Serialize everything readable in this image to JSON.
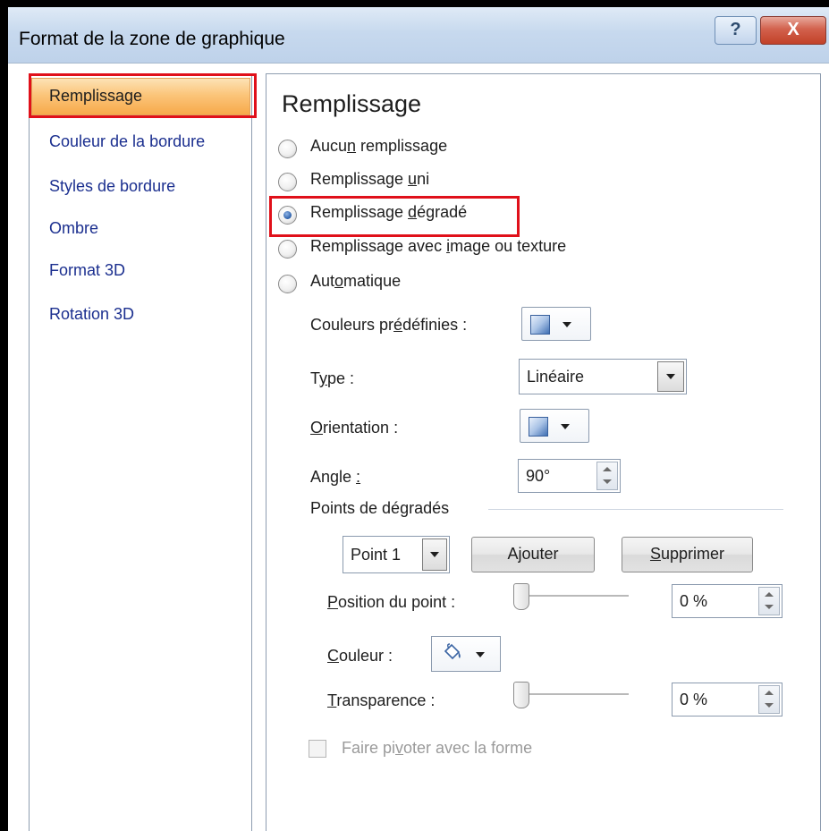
{
  "window": {
    "title": "Format de la zone de graphique",
    "help_label": "?",
    "close_label": "X"
  },
  "sidebar": {
    "items": [
      {
        "label": "Remplissage",
        "selected": true
      },
      {
        "label": "Couleur de la bordure"
      },
      {
        "label": "Styles de bordure"
      },
      {
        "label": "Ombre"
      },
      {
        "label": "Format 3D"
      },
      {
        "label": "Rotation 3D"
      }
    ]
  },
  "main": {
    "heading": "Remplissage",
    "fill_options": [
      {
        "pre": "Aucu",
        "u": "n",
        "post": " remplissage",
        "selected": false
      },
      {
        "pre": "Remplissage ",
        "u": "u",
        "post": "ni",
        "selected": false
      },
      {
        "pre": "Remplissage ",
        "u": "d",
        "post": "égradé",
        "selected": true
      },
      {
        "pre": "Remplissage avec ",
        "u": "i",
        "post": "mage ou texture",
        "selected": false
      },
      {
        "pre": "Aut",
        "u": "o",
        "post": "matique",
        "selected": false
      }
    ],
    "preset_colors": {
      "pre": "Couleurs pr",
      "u": "é",
      "post": "définies :"
    },
    "type": {
      "pre": "T",
      "u": "y",
      "post": "pe :",
      "value": "Linéaire"
    },
    "orientation": {
      "pre": "",
      "u": "O",
      "post": "rientation :"
    },
    "angle": {
      "pre": "Angle ",
      "u": ":",
      "post": "",
      "value": "90°"
    },
    "gradient_stops": {
      "group_label": "Points de dégradés",
      "stop_value": "Point 1",
      "add": {
        "pre": "A",
        "u": "j",
        "post": "outer"
      },
      "remove": {
        "pre": "",
        "u": "S",
        "post": "upprimer"
      },
      "position": {
        "pre": "",
        "u": "P",
        "post": "osition du point :",
        "value": "0 %",
        "slider_fraction": 0
      },
      "color": {
        "pre": "",
        "u": "C",
        "post": "ouleur :"
      },
      "transparency": {
        "pre": "",
        "u": "T",
        "post": "ransparence :",
        "value": "0 %",
        "slider_fraction": 0
      }
    },
    "rotate_with_shape": {
      "pre": "Faire pi",
      "u": "v",
      "post": "oter avec la forme",
      "checked": false,
      "disabled": true
    }
  },
  "colors": {
    "highlight_red": "#e0101a",
    "selection_orange": "#f7a94a",
    "nav_blue": "#1b2f8f"
  }
}
